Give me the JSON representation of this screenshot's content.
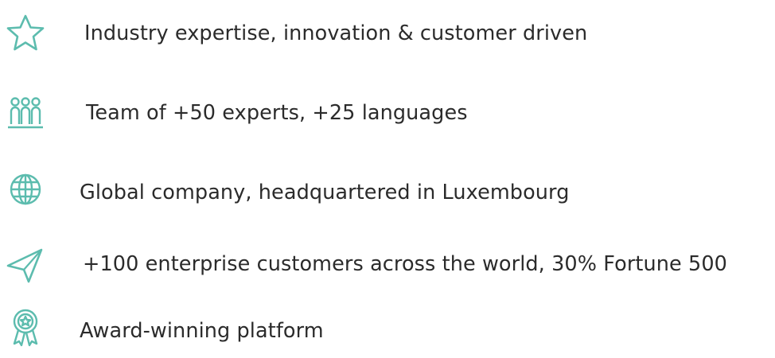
{
  "accent_color": "#5cbcae",
  "features": [
    {
      "icon": "star-icon",
      "text": "Industry expertise, innovation & customer driven"
    },
    {
      "icon": "team-icon",
      "text": "Team of +50 experts, +25 languages"
    },
    {
      "icon": "globe-icon",
      "text": "Global company, headquartered in Luxembourg"
    },
    {
      "icon": "send-icon",
      "text": "+100 enterprise customers across the world, 30% Fortune 500"
    },
    {
      "icon": "award-icon",
      "text": "Award-winning platform"
    }
  ]
}
